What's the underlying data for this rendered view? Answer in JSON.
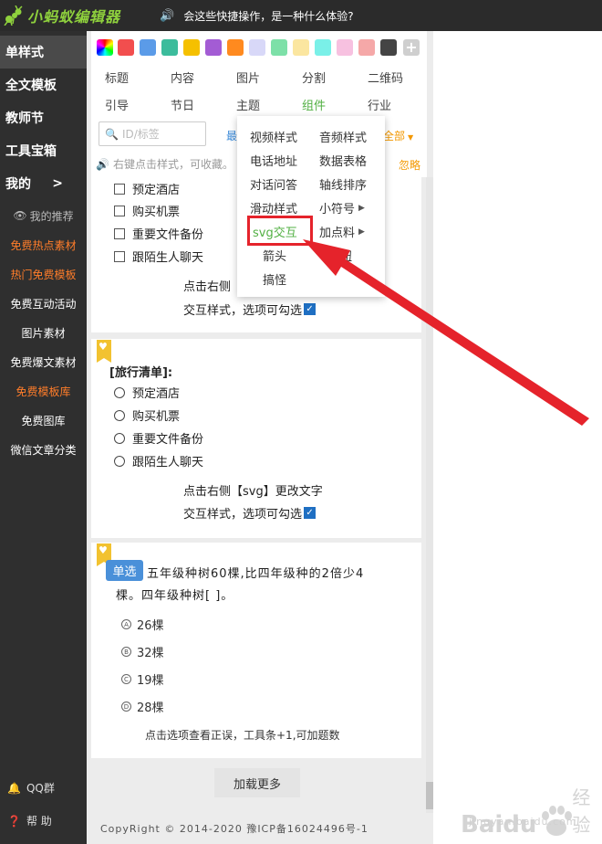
{
  "app": {
    "logo_text": "小蚂蚁编辑器",
    "notice": "会这些快捷操作，是一种什么体验?",
    "brand_color": "#8fd13d",
    "accent_color": "#52b043"
  },
  "sidebar": {
    "items": [
      {
        "label": "单样式"
      },
      {
        "label": "全文模板"
      },
      {
        "label": "教师节"
      },
      {
        "label": "工具宝箱"
      },
      {
        "label": "我的",
        "arrow": ">"
      }
    ],
    "recommend_label": "我的推荐",
    "sub_items": [
      {
        "label": "免费热点素材"
      },
      {
        "label": "热门免费模板"
      },
      {
        "label": "免费互动活动"
      },
      {
        "label": "图片素材"
      },
      {
        "label": "免费爆文素材"
      },
      {
        "label": "免费模板库"
      },
      {
        "label": "免费图库"
      },
      {
        "label": "微信文章分类"
      }
    ],
    "qq_group": "QQ群",
    "help": "帮 助"
  },
  "toolbox": {
    "swatches": [
      "#f24e4e",
      "#5b9be8",
      "#3cbc9c",
      "#f5c000",
      "#a35cd4",
      "#ff8a1f",
      "#d8d8f8",
      "#7de0a8",
      "#fbe6a0",
      "#7af0e8",
      "#f7c1e0",
      "#f5a8a8",
      "#444444"
    ],
    "categories_row1": [
      "标题",
      "内容",
      "图片",
      "分割",
      "二维码"
    ],
    "categories_row2": [
      "引导",
      "节日",
      "主题",
      "组件",
      "行业"
    ],
    "active_category": "组件",
    "search_placeholder": "ID/标签",
    "sort_label": "最",
    "filter_label": "全部",
    "hint": "右键点击样式，可收藏。",
    "ignore": "忽略"
  },
  "dropdown": {
    "left": [
      "视频样式",
      "电话地址",
      "对话问答",
      "滑动样式",
      "svg交互",
      "箭头",
      "搞怪"
    ],
    "right": [
      "音频样式",
      "数据表格",
      "轴线排序",
      "小符号",
      "加点料",
      "按钮"
    ],
    "highlighted": "svg交互"
  },
  "cards": {
    "checklist_items": [
      "预定酒店",
      "购买机票",
      "重要文件备份",
      "跟陌生人聊天"
    ],
    "tip_line1_partial": "点击右侧",
    "tip_line2": "交互样式，选项可勾选",
    "radio_title": "[旅行清单]:",
    "radio_items": [
      "预定酒店",
      "购买机票",
      "重要文件备份",
      "跟陌生人聊天"
    ],
    "tip_line1_full": "点击右侧【svg】更改文字",
    "check_mark": "✓"
  },
  "quiz": {
    "tag": "单选",
    "question_line1": "五年级种树60棵,比四年级种的2倍少4",
    "question_line2": "棵。四年级种树[      ]。",
    "options": [
      {
        "mark": "A",
        "text": "26棵"
      },
      {
        "mark": "B",
        "text": "32棵"
      },
      {
        "mark": "C",
        "text": "19棵"
      },
      {
        "mark": "D",
        "text": "28棵"
      }
    ],
    "footer_tip": "点击选项查看正误，工具条+1,可加题数"
  },
  "load_more": "加载更多",
  "footer": "CopyRight © 2014-2020 豫ICP备16024496号-1",
  "watermark": {
    "text": "Baidu",
    "suffix": "经验",
    "url": "jingyan.baidu.com"
  }
}
